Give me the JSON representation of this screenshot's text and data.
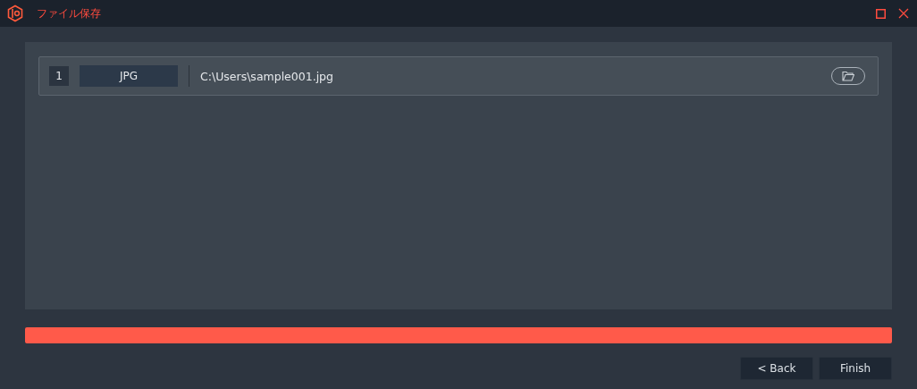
{
  "window": {
    "title": "ファイル保存"
  },
  "files": [
    {
      "index": "1",
      "format": "JPG",
      "path": "C:\\Users\\sample001.jpg"
    }
  ],
  "progress": {
    "level": 1
  },
  "buttons": [
    {
      "label": "< Back"
    },
    {
      "label": "Finish"
    }
  ]
}
